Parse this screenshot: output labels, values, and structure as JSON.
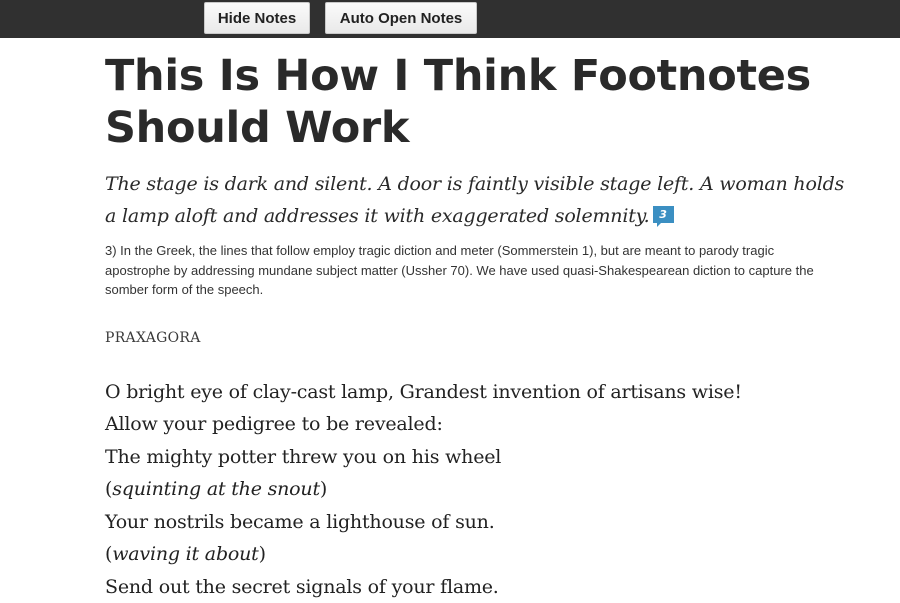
{
  "toolbar": {
    "hide_notes_label": "Hide Notes",
    "auto_open_notes_label": "Auto Open Notes"
  },
  "article": {
    "title": "This Is How I Think Footnotes Should Work",
    "intro": "The stage is dark and silent.  A door is faintly visible stage left.  A woman holds a lamp aloft and addresses it with exaggerated solemnity.",
    "note_marker": "3",
    "footnote": "3) In the Greek, the lines that follow employ tragic diction and meter (Sommerstein 1), but are meant to parody tragic apostrophe by addressing mundane subject matter (Ussher 70). We have used quasi-Shakespearean diction to capture the somber form of the speech.",
    "speaker": "PRAXAGORA",
    "verse": {
      "line1": "O bright eye of clay-cast lamp,  Grandest invention of artisans wise!",
      "line2": "Allow your pedigree to be revealed:",
      "line3": "The mighty potter threw you on his wheel",
      "stage_direction1": "squinting at the snout",
      "line5": "Your nostrils became a lighthouse of sun.",
      "stage_direction2": "waving it about",
      "line7": "Send out the secret signals of your flame."
    }
  },
  "colors": {
    "topbar": "#303030",
    "note_marker": "#3b8fc2"
  }
}
